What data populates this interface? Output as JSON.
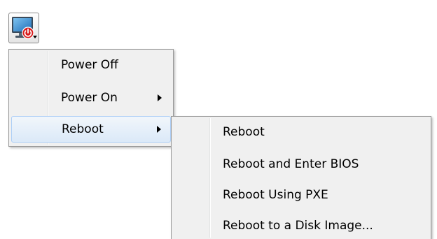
{
  "toolbar": {
    "button_icon": "monitor-power-icon",
    "accent_color": "#d81b1b"
  },
  "power_menu": {
    "items": [
      {
        "label": "Power Off",
        "has_submenu": false,
        "highlighted": false
      },
      {
        "label": "Power On",
        "has_submenu": true,
        "highlighted": false
      },
      {
        "label": "Reboot",
        "has_submenu": true,
        "highlighted": true
      }
    ]
  },
  "reboot_submenu": {
    "items": [
      {
        "label": "Reboot"
      },
      {
        "label": "Reboot and Enter BIOS"
      },
      {
        "label": "Reboot Using PXE"
      },
      {
        "label": "Reboot to a Disk Image..."
      }
    ]
  }
}
